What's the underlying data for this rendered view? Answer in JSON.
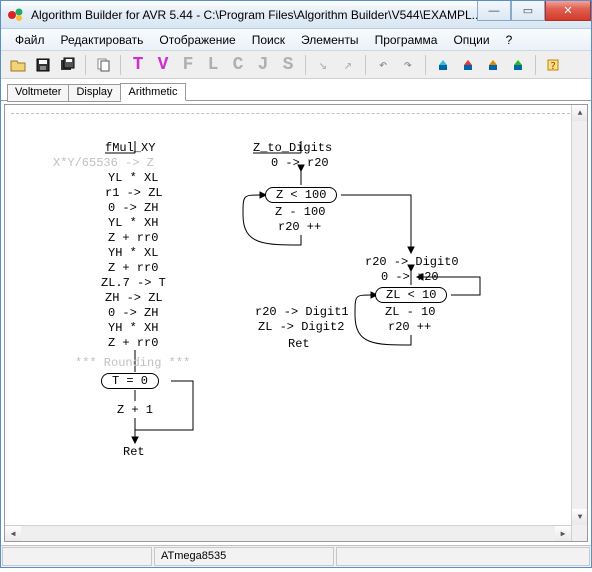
{
  "window": {
    "title": "Algorithm Builder for AVR 5.44 - C:\\Program Files\\Algorithm Builder\\V544\\EXAMPL..."
  },
  "menu": {
    "file": "Файл",
    "edit": "Редактировать",
    "view": "Отображение",
    "search": "Поиск",
    "elements": "Элементы",
    "program": "Программа",
    "options": "Опции",
    "help": "?"
  },
  "toolbar": {
    "letters": [
      "T",
      "V",
      "F",
      "L",
      "C",
      "J",
      "S"
    ],
    "letter_colors": [
      "#d030d0",
      "#d030d0",
      "#b0b0b0",
      "#b0b0b0",
      "#b0b0b0",
      "#b0b0b0",
      "#b0b0b0"
    ]
  },
  "tabs": {
    "items": [
      {
        "label": "Voltmeter",
        "active": false
      },
      {
        "label": "Display",
        "active": false
      },
      {
        "label": "Arithmetic",
        "active": true
      }
    ]
  },
  "algo": {
    "left": {
      "title": "fMul_XY",
      "comment": "X*Y/65536 -> Z",
      "lines": [
        "YL * XL",
        "r1 -> ZL",
        "0 -> ZH",
        "YL * XH",
        "Z + rr0",
        "YH * XL",
        "Z + rr0",
        "ZL.7 -> T",
        "ZH -> ZL",
        "0 -> ZH",
        "YH * XH",
        "Z + rr0"
      ],
      "roundcomment": "*** Rounding ***",
      "cond": "T = 0",
      "after": "Z + 1",
      "ret": "Ret"
    },
    "right": {
      "title": "Z_to_Digits",
      "a1": "0 -> r20",
      "cond1": "Z < 100",
      "b1": "Z - 100",
      "b2": "r20 ++",
      "c1": "r20 -> Digit0",
      "c2": "0 -> r20",
      "cond2": "ZL < 10",
      "d1": "ZL - 10",
      "d2": "r20 ++",
      "e1": "r20 -> Digit1",
      "e2": "ZL -> Digit2",
      "ret": "Ret"
    }
  },
  "status": {
    "chip": "ATmega8535"
  }
}
